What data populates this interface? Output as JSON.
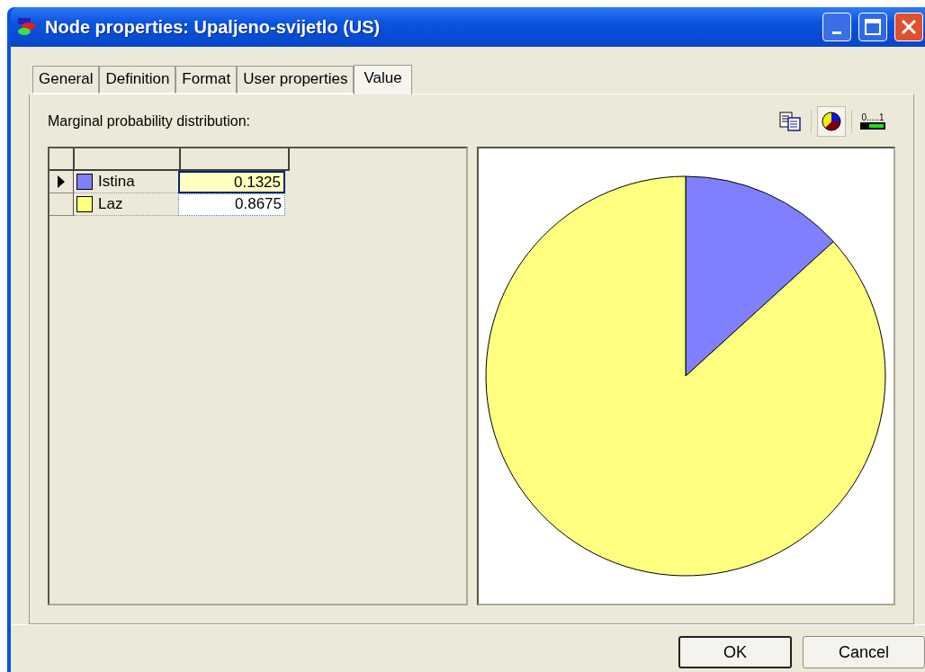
{
  "window": {
    "title": "Node properties:  Upaljeno-svijetlo (US)"
  },
  "tabs": [
    {
      "label": "General",
      "selected": false
    },
    {
      "label": "Definition",
      "selected": false
    },
    {
      "label": "Format",
      "selected": false
    },
    {
      "label": "User properties",
      "selected": false
    },
    {
      "label": "Value",
      "selected": true
    }
  ],
  "value_page": {
    "heading": "Marginal probability distribution:",
    "toolbar": [
      {
        "kind": "copy",
        "selected": false
      },
      {
        "kind": "pie",
        "selected": true
      },
      {
        "kind": "bar",
        "selected": false,
        "label": "0.....1"
      }
    ],
    "rows": [
      {
        "state": "Istina",
        "color": "#8080ff",
        "value": "0.1325",
        "selected": true
      },
      {
        "state": "Laz",
        "color": "#ffff80",
        "value": "0.8675",
        "selected": false
      }
    ],
    "chart_data": {
      "type": "pie",
      "values": [
        0.1325,
        0.8675
      ],
      "colors": [
        "#8080ff",
        "#ffff80"
      ]
    }
  },
  "buttons": [
    {
      "label": "OK",
      "default": true
    },
    {
      "label": "Cancel",
      "default": false
    }
  ]
}
